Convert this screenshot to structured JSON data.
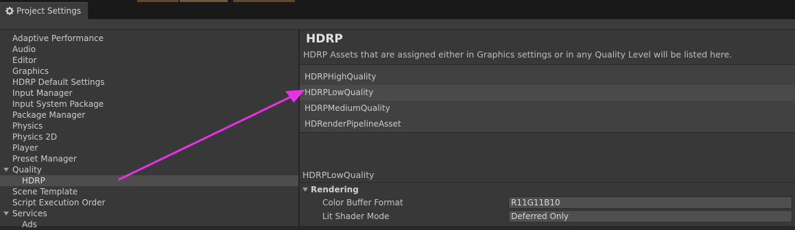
{
  "window": {
    "title": "Project Settings",
    "icon": "gear-icon"
  },
  "sidebar": {
    "items": [
      {
        "label": "Adaptive Performance",
        "level": 0
      },
      {
        "label": "Audio",
        "level": 0
      },
      {
        "label": "Editor",
        "level": 0
      },
      {
        "label": "Graphics",
        "level": 0
      },
      {
        "label": "HDRP Default Settings",
        "level": 0
      },
      {
        "label": "Input Manager",
        "level": 0
      },
      {
        "label": "Input System Package",
        "level": 0
      },
      {
        "label": "Package Manager",
        "level": 0
      },
      {
        "label": "Physics",
        "level": 0
      },
      {
        "label": "Physics 2D",
        "level": 0
      },
      {
        "label": "Player",
        "level": 0
      },
      {
        "label": "Preset Manager",
        "level": 0
      },
      {
        "label": "Quality",
        "level": 0,
        "expanded": true
      },
      {
        "label": "HDRP",
        "level": 1,
        "selected": true
      },
      {
        "label": "Scene Template",
        "level": 0
      },
      {
        "label": "Script Execution Order",
        "level": 0
      },
      {
        "label": "Services",
        "level": 0,
        "expanded": true
      },
      {
        "label": "Ads",
        "level": 1
      }
    ]
  },
  "main": {
    "title": "HDRP",
    "description": "HDRP Assets that are assigned either in Graphics settings or in any Quality Level will be listed here.",
    "assets": [
      {
        "label": "HDRPHighQuality"
      },
      {
        "label": "HDRPLowQuality",
        "selected": true
      },
      {
        "label": "HDRPMediumQuality"
      },
      {
        "label": "HDRenderPipelineAsset"
      }
    ],
    "selected_asset": "HDRPLowQuality",
    "section": {
      "label": "Rendering",
      "properties": [
        {
          "label": "Color Buffer Format",
          "value": "R11G11B10"
        },
        {
          "label": "Lit Shader Mode",
          "value": "Deferred Only"
        }
      ]
    }
  },
  "colors": {
    "annotation_arrow": "#e632e6",
    "background": "#383838"
  }
}
